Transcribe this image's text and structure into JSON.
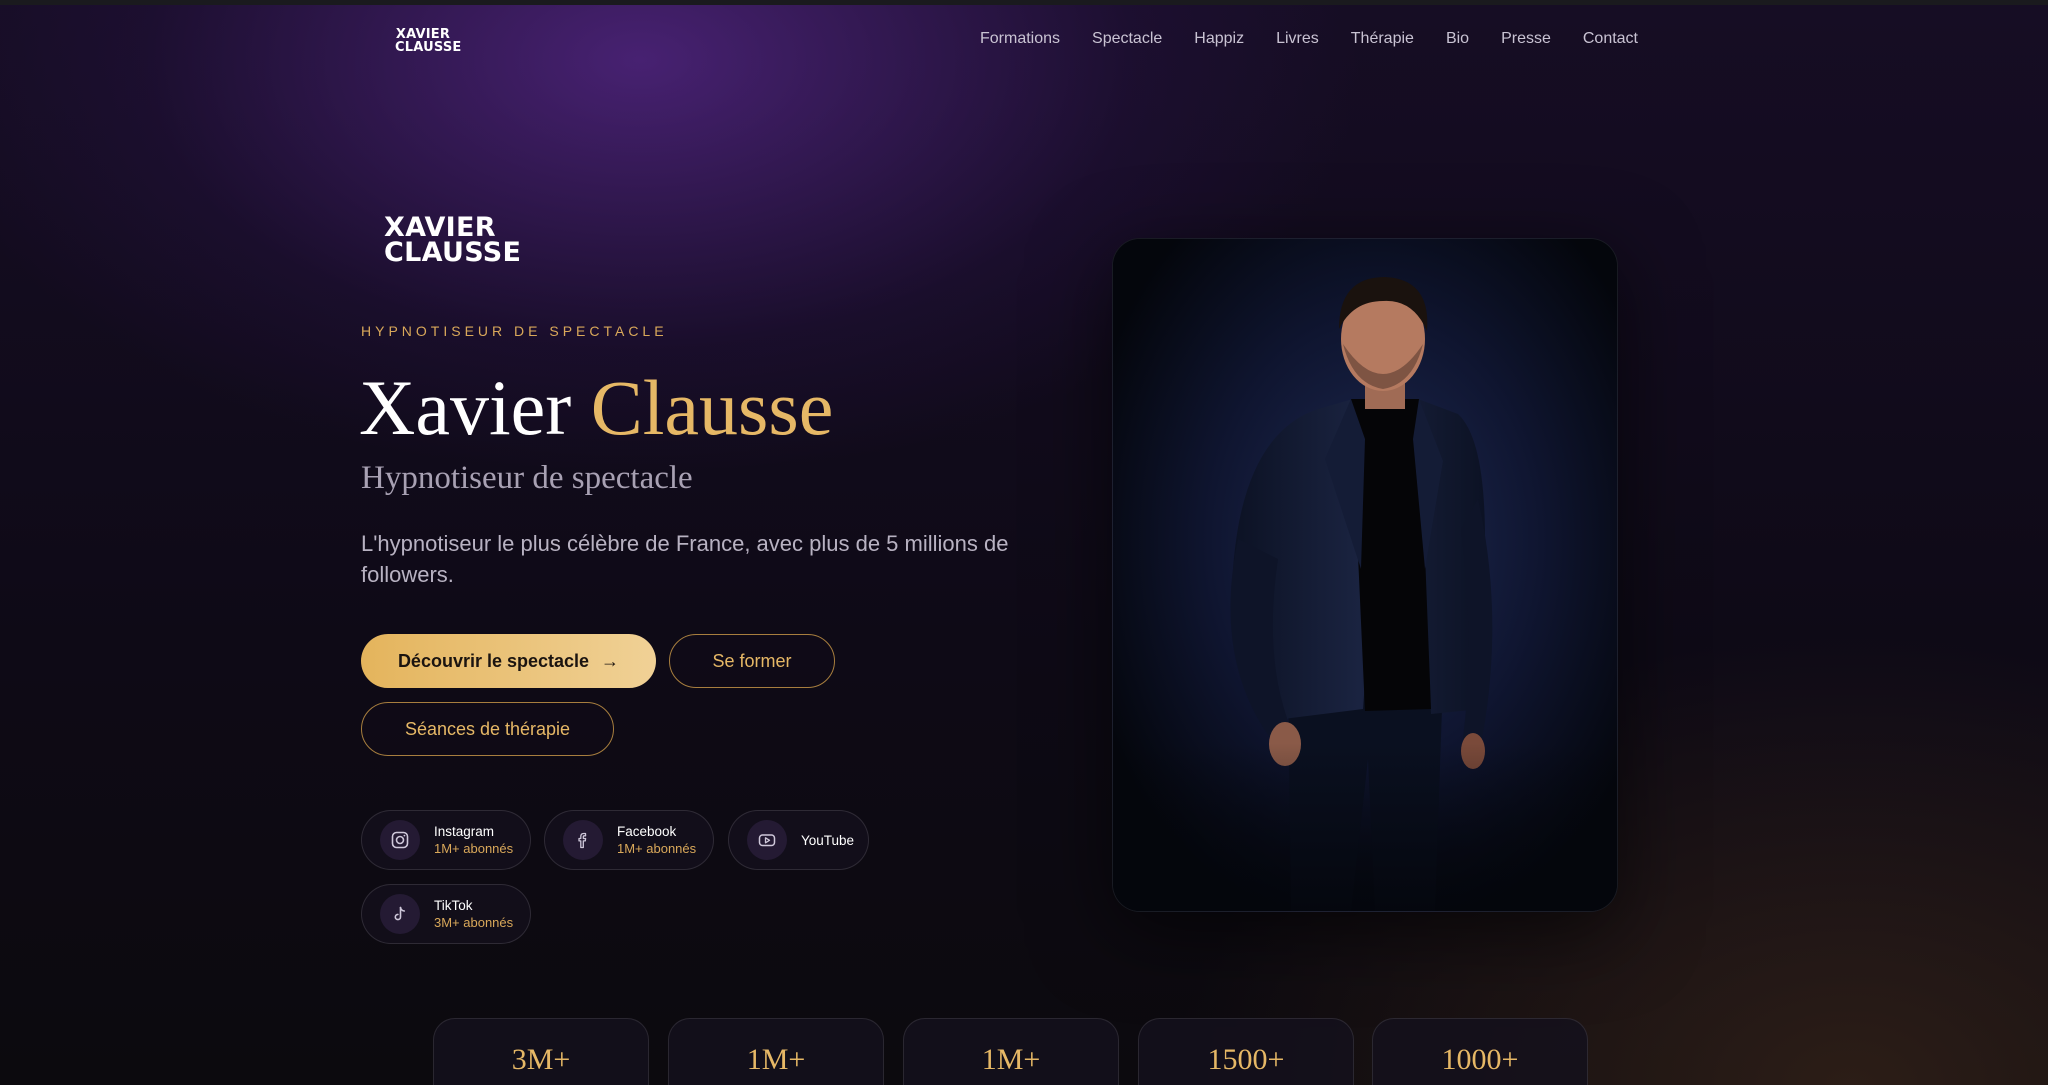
{
  "nav": {
    "logo_line1": "XAVIER",
    "logo_line2": "CLAUSSE",
    "links": [
      "Formations",
      "Spectacle",
      "Happiz",
      "Livres",
      "Thérapie",
      "Bio",
      "Presse",
      "Contact"
    ]
  },
  "hero": {
    "logo_line1": "XAVIER",
    "logo_line2": "CLAUSSE",
    "eyebrow": "HYPNOTISEUR DE SPECTACLE",
    "first_name": "Xavier",
    "last_name": "Clausse",
    "subtitle": "Hypnotiseur de spectacle",
    "description": "L'hypnotiseur le plus célèbre de France, avec plus de 5 millions de followers.",
    "primary_cta": "Découvrir le spectacle",
    "secondary_cta": "Se former",
    "tertiary_cta": "Séances de thérapie"
  },
  "socials": [
    {
      "name": "Instagram",
      "followers": "1M+ abonnés",
      "icon": "instagram-icon"
    },
    {
      "name": "Facebook",
      "followers": "1M+ abonnés",
      "icon": "facebook-icon"
    },
    {
      "name": "YouTube",
      "followers": "",
      "icon": "youtube-icon"
    },
    {
      "name": "TikTok",
      "followers": "3M+ abonnés",
      "icon": "tiktok-icon"
    }
  ],
  "stats": [
    "3M+",
    "1M+",
    "1M+",
    "1500+",
    "1000+"
  ],
  "colors": {
    "accent_gold": "#e6b866",
    "background": "#0e0a16",
    "purple_glow": "#58288c"
  }
}
